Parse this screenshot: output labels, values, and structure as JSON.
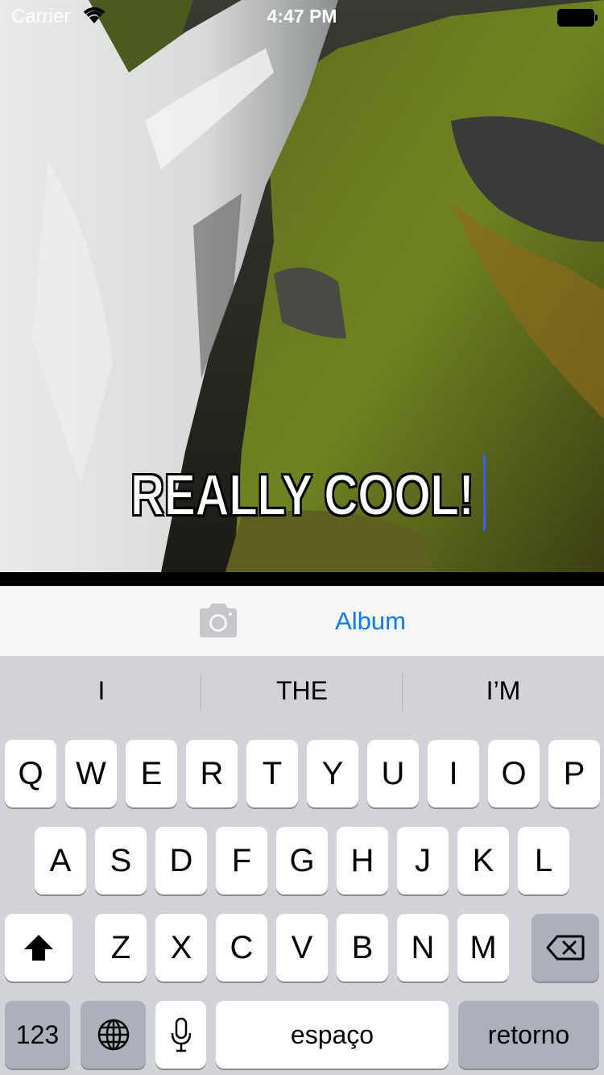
{
  "status_bar": {
    "carrier": "Carrier",
    "time": "4:47 PM",
    "wifi_icon": "wifi-icon",
    "battery_icon": "battery-icon"
  },
  "photo": {
    "caption": "REALLY COOL!"
  },
  "toolbar": {
    "camera_icon": "camera-icon",
    "album_label": "Album",
    "accent_color": "#0a7aff"
  },
  "keyboard": {
    "predictions": [
      "I",
      "THE",
      "I’M"
    ],
    "row1": [
      "Q",
      "W",
      "E",
      "R",
      "T",
      "Y",
      "U",
      "I",
      "O",
      "P"
    ],
    "row2": [
      "A",
      "S",
      "D",
      "F",
      "G",
      "H",
      "J",
      "K",
      "L"
    ],
    "row3": [
      "Z",
      "X",
      "C",
      "V",
      "B",
      "N",
      "M"
    ],
    "numbers_label": "123",
    "space_label": "espaço",
    "return_label": "retorno",
    "shift_icon": "shift-icon",
    "delete_icon": "delete-icon",
    "globe_icon": "globe-icon",
    "mic_icon": "microphone-icon"
  }
}
